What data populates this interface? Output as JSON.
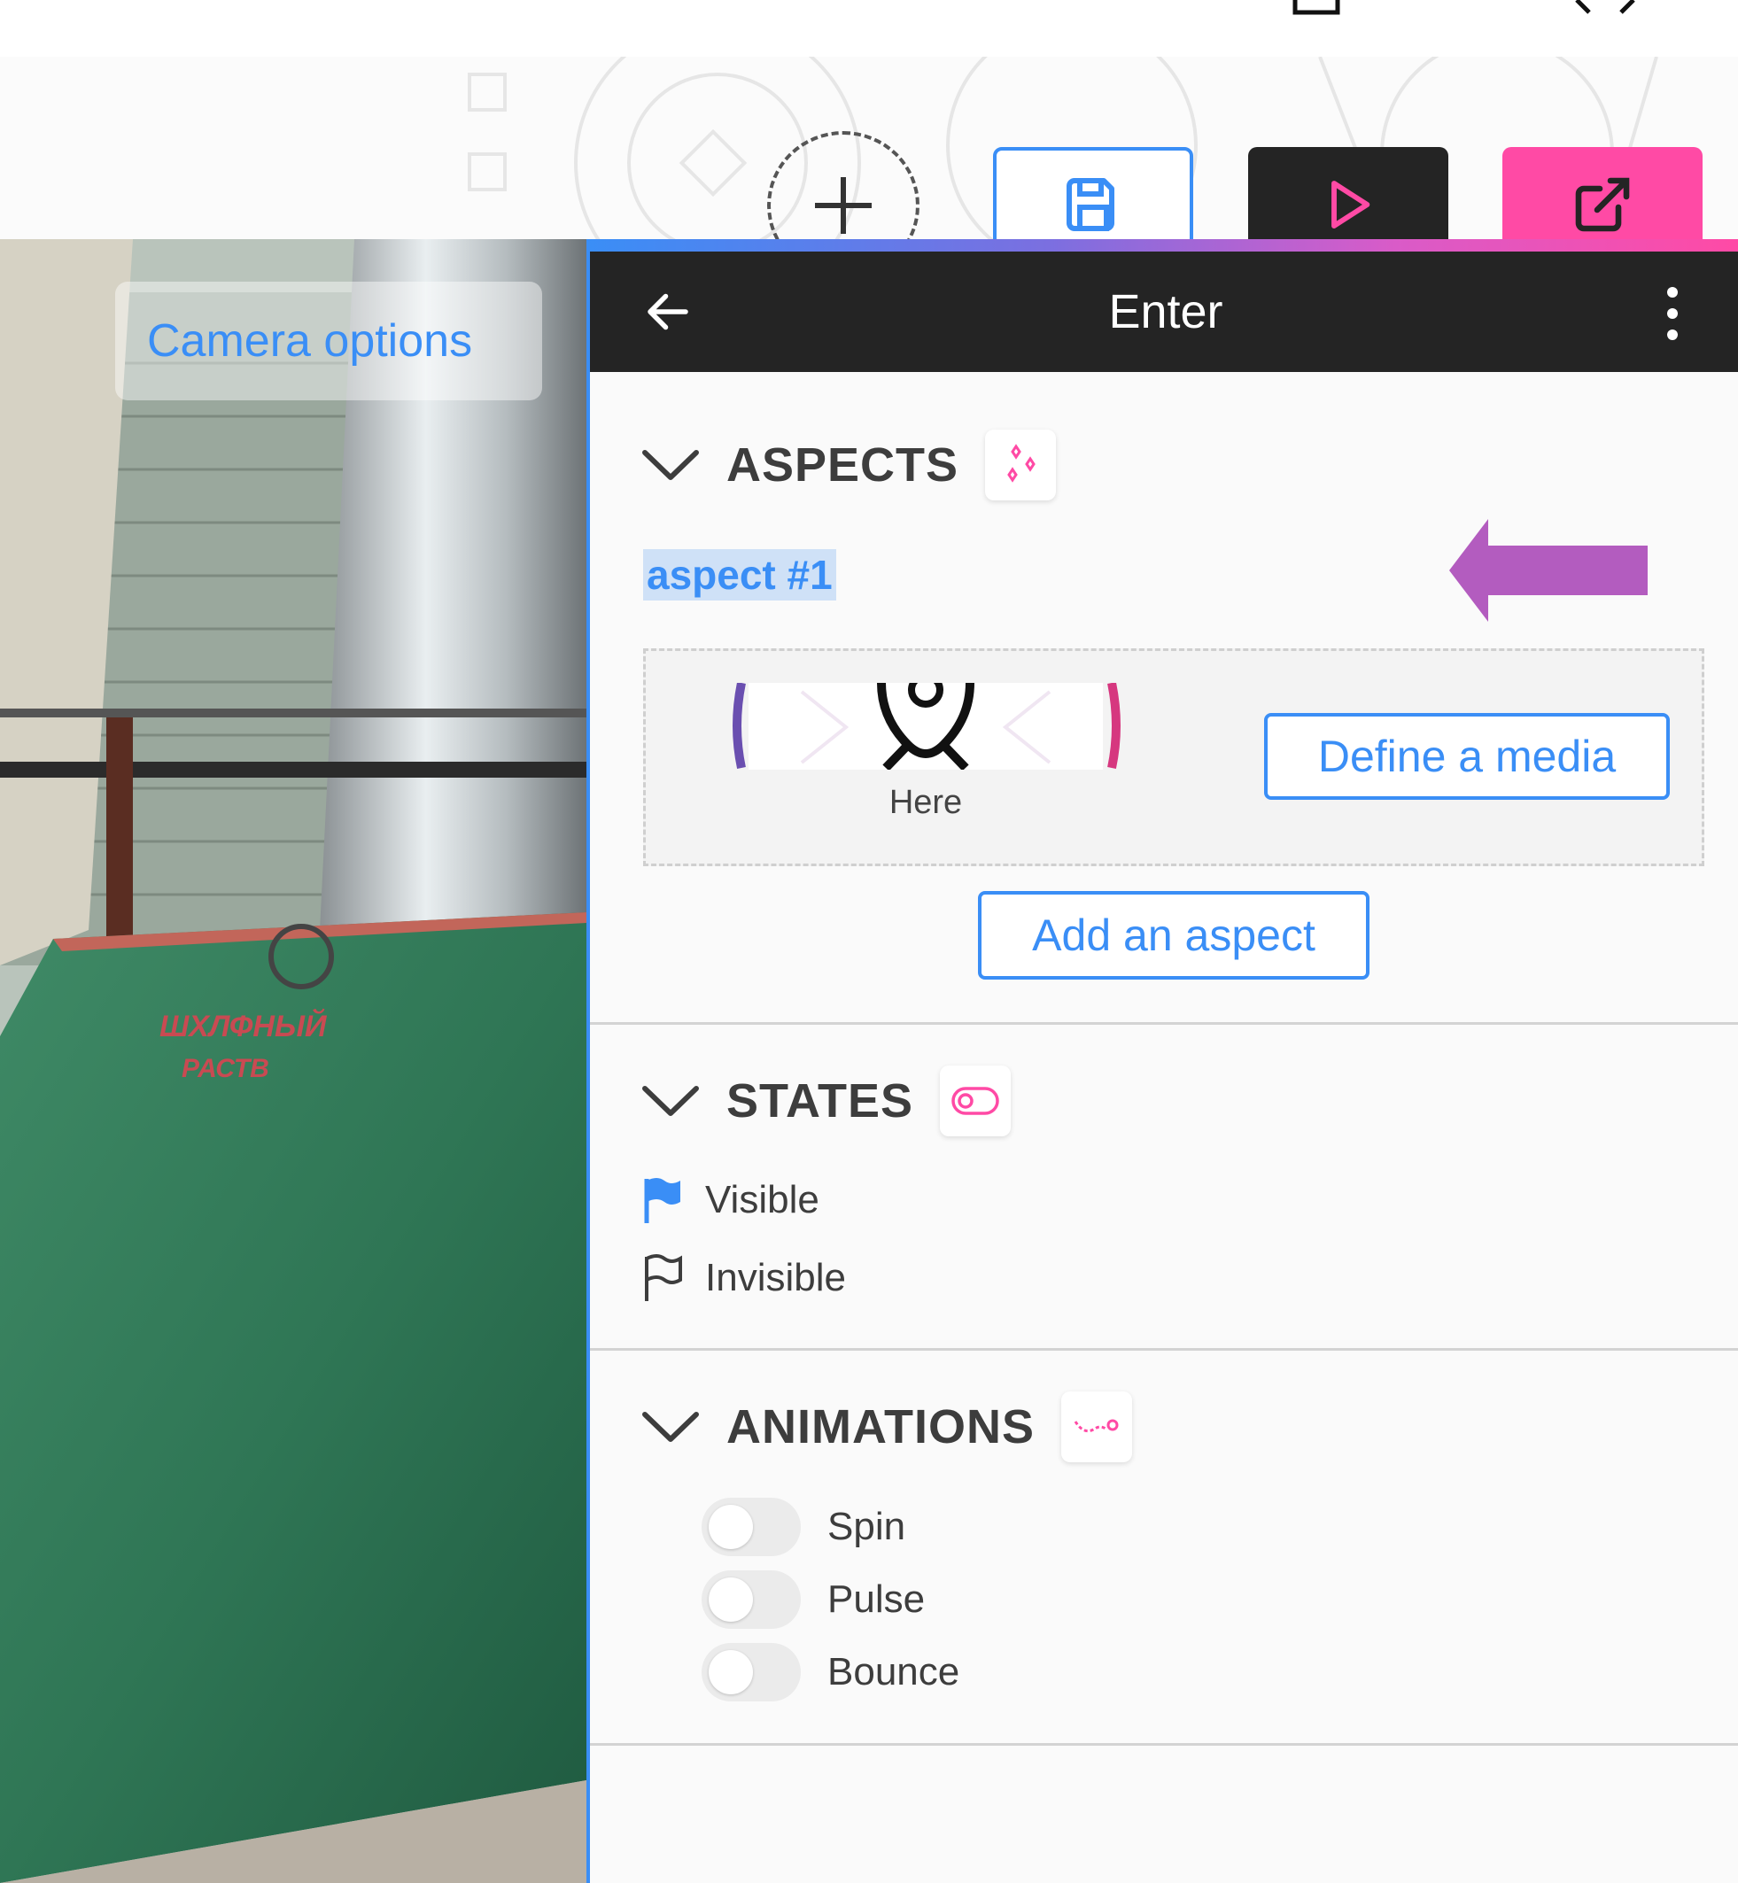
{
  "viewport": {
    "camera_options_label": "Camera options"
  },
  "panel": {
    "title": "Enter",
    "aspects": {
      "title": "ASPECTS",
      "aspect_name": "aspect #1",
      "media_caption": "Here",
      "define_media_label": "Define a media",
      "add_aspect_label": "Add an aspect"
    },
    "states": {
      "title": "STATES",
      "items": [
        "Visible",
        "Invisible"
      ]
    },
    "animations": {
      "title": "ANIMATIONS",
      "items": [
        "Spin",
        "Pulse",
        "Bounce"
      ]
    }
  },
  "icons": {
    "toolbar": [
      "add-icon",
      "save-icon",
      "play-icon",
      "external-link-icon"
    ],
    "panel": [
      "back-arrow-icon",
      "kebab-menu-icon",
      "sparkles-icon",
      "toggle-icon",
      "motion-path-icon",
      "flag-filled-icon",
      "flag-outline-icon"
    ]
  },
  "colors": {
    "accent_blue": "#3a8ef6",
    "accent_pink": "#ff4aa5",
    "header_dark": "#242424",
    "annotation_purple": "#b35cbf"
  }
}
